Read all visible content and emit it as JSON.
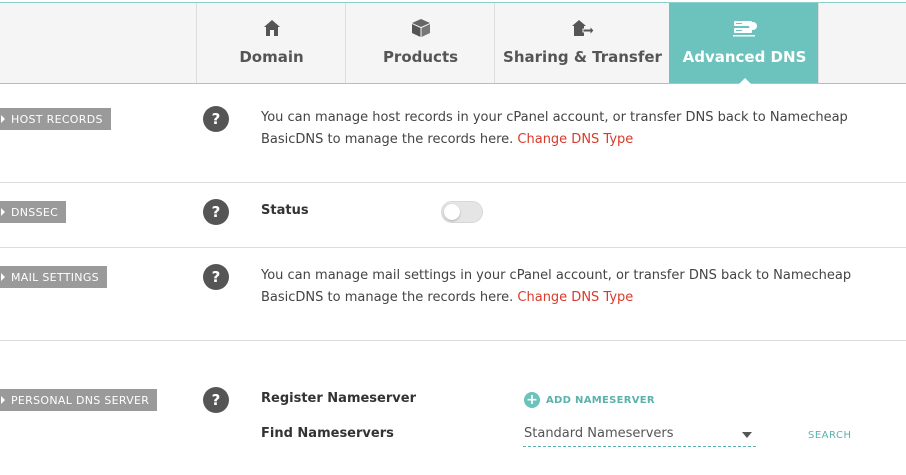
{
  "tabs": [
    {
      "label": "Domain",
      "icon": "house-icon"
    },
    {
      "label": "Products",
      "icon": "box-icon"
    },
    {
      "label": "Sharing & Transfer",
      "icon": "house-arrow-icon"
    },
    {
      "label": "Advanced DNS",
      "icon": "dns-server-icon",
      "active": true
    }
  ],
  "host_records": {
    "tag": "HOST RECORDS",
    "help": "?",
    "text": "You can manage host records in your cPanel account, or transfer DNS back to Namecheap BasicDNS to manage the records here.",
    "link": "Change DNS Type"
  },
  "dnssec": {
    "tag": "DNSSEC",
    "help": "?",
    "status_label": "Status",
    "enabled": false
  },
  "mail_settings": {
    "tag": "MAIL SETTINGS",
    "help": "?",
    "text": "You can manage mail settings in your cPanel account, or transfer DNS back to Namecheap BasicDNS to manage the records here.",
    "link": "Change DNS Type"
  },
  "personal_dns": {
    "tag": "PERSONAL DNS SERVER",
    "help": "?",
    "register_label": "Register Nameserver",
    "add_label": "ADD NAMESERVER",
    "find_label": "Find Nameservers",
    "select_value": "Standard Nameservers",
    "search_label": "SEARCH"
  },
  "colors": {
    "accent": "#6cc2bc",
    "link": "#d93a2b",
    "tag_bg": "#9a9a9a"
  }
}
